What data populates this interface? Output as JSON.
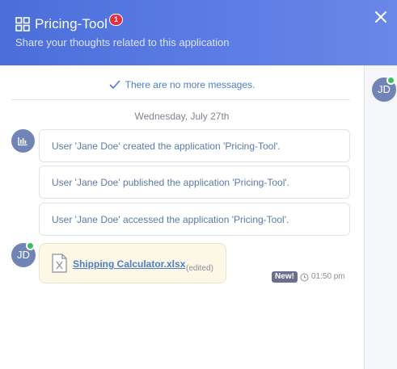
{
  "header": {
    "app_icon": "grid-icon",
    "title": "Pricing-Tool",
    "notification_count": "1",
    "subtitle": "Share your thoughts related to this application",
    "close_icon": "close-icon"
  },
  "colors": {
    "header_gradient_start": "#4a6ed8",
    "header_gradient_end": "#6a86e8",
    "link": "#4a7fc7",
    "badge_red": "#e0333f",
    "online_green": "#3cbf5b",
    "avatar_bg": "#7085b6"
  },
  "sidebar": {
    "avatar_initials": "JD",
    "online": true
  },
  "conversation": {
    "no_more_messages": "There are no more messages.",
    "date": "Wednesday, July 27th",
    "system_icon": "bar-chart-icon",
    "system_messages": [
      "User 'Jane Doe' created the application 'Pricing-Tool'.",
      "User 'Jane Doe' published the application 'Pricing-Tool'.",
      "User 'Jane Doe' accessed the application 'Pricing-Tool'."
    ],
    "user_message": {
      "avatar_initials": "JD",
      "online": true,
      "file_icon": "excel-file-icon",
      "file_name": "Shipping Calculator.xlsx",
      "edited_label": "(edited)",
      "new_label": "New!",
      "time": "01:50 pm"
    }
  }
}
